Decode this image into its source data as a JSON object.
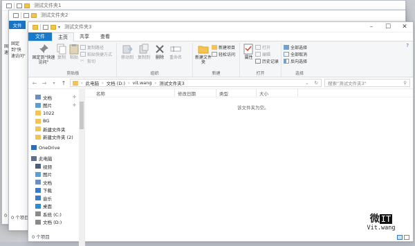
{
  "windows": {
    "back1_title": "测试文件夹1",
    "back2_title": "测试文件夹2",
    "main_title": "测试文件夹3"
  },
  "back_panes": {
    "file_tab": "文件",
    "w2_lines": [
      "固定到\"快",
      "速访问\""
    ],
    "w1_lines": [
      "固定到\"",
      "速访问"
    ],
    "status": "0 个项目"
  },
  "tabs": {
    "file": "文件",
    "home": "主页",
    "share": "共享",
    "view": "查看"
  },
  "ribbon": {
    "clipboard": {
      "label": "剪贴板",
      "pin": "固定到\"快速访问\"",
      "copy": "复制",
      "paste": "粘贴",
      "copy_path": "复制路径",
      "paste_shortcut": "粘贴快捷方式",
      "cut": "剪切"
    },
    "organize": {
      "label": "组织",
      "move_to": "移动到",
      "copy_to": "复制到",
      "delete": "删除",
      "rename": "重命名"
    },
    "new": {
      "label": "新建",
      "new_folder": "新建文件夹",
      "new_item": "新建项目",
      "easy_access": "轻松访问"
    },
    "open": {
      "label": "打开",
      "properties": "属性",
      "open": "打开",
      "edit": "编辑",
      "history": "历史记录"
    },
    "select": {
      "label": "选择",
      "select_all": "全部选择",
      "select_none": "全部取消",
      "invert": "反向选择"
    }
  },
  "address": {
    "crumbs": [
      "此电脑",
      "文档 (D:)",
      "vit.wang",
      "测试文件夹3"
    ],
    "search_placeholder": "搜索\"测试文件夹3\""
  },
  "nav": {
    "items": [
      {
        "label": "文档",
        "pinned": true
      },
      {
        "label": "图片",
        "pinned": true
      },
      {
        "label": "1022",
        "pinned": false
      },
      {
        "label": "BG",
        "pinned": false
      },
      {
        "label": "新建文件夹",
        "pinned": false
      },
      {
        "label": "新建文件夹 (2)",
        "pinned": false
      },
      {
        "label": "OneDrive",
        "pinned": false
      },
      {
        "label": "此电脑",
        "pinned": false
      },
      {
        "label": "视频",
        "pinned": false
      },
      {
        "label": "图片",
        "pinned": false
      },
      {
        "label": "文档",
        "pinned": false
      },
      {
        "label": "下载",
        "pinned": false
      },
      {
        "label": "音乐",
        "pinned": false
      },
      {
        "label": "桌面",
        "pinned": false
      },
      {
        "label": "系统 (C:)",
        "pinned": false
      },
      {
        "label": "文档 (D:)",
        "pinned": false
      }
    ]
  },
  "columns": [
    "名称",
    "修改日期",
    "类型",
    "大小"
  ],
  "empty_message": "该文件夹为空。",
  "status": "0 个项目",
  "watermark": {
    "top": "微",
    "badge": "IT",
    "bottom": "Vit.wang"
  },
  "colors": {
    "accent": "#1979ca",
    "folder": "#f3c453"
  }
}
